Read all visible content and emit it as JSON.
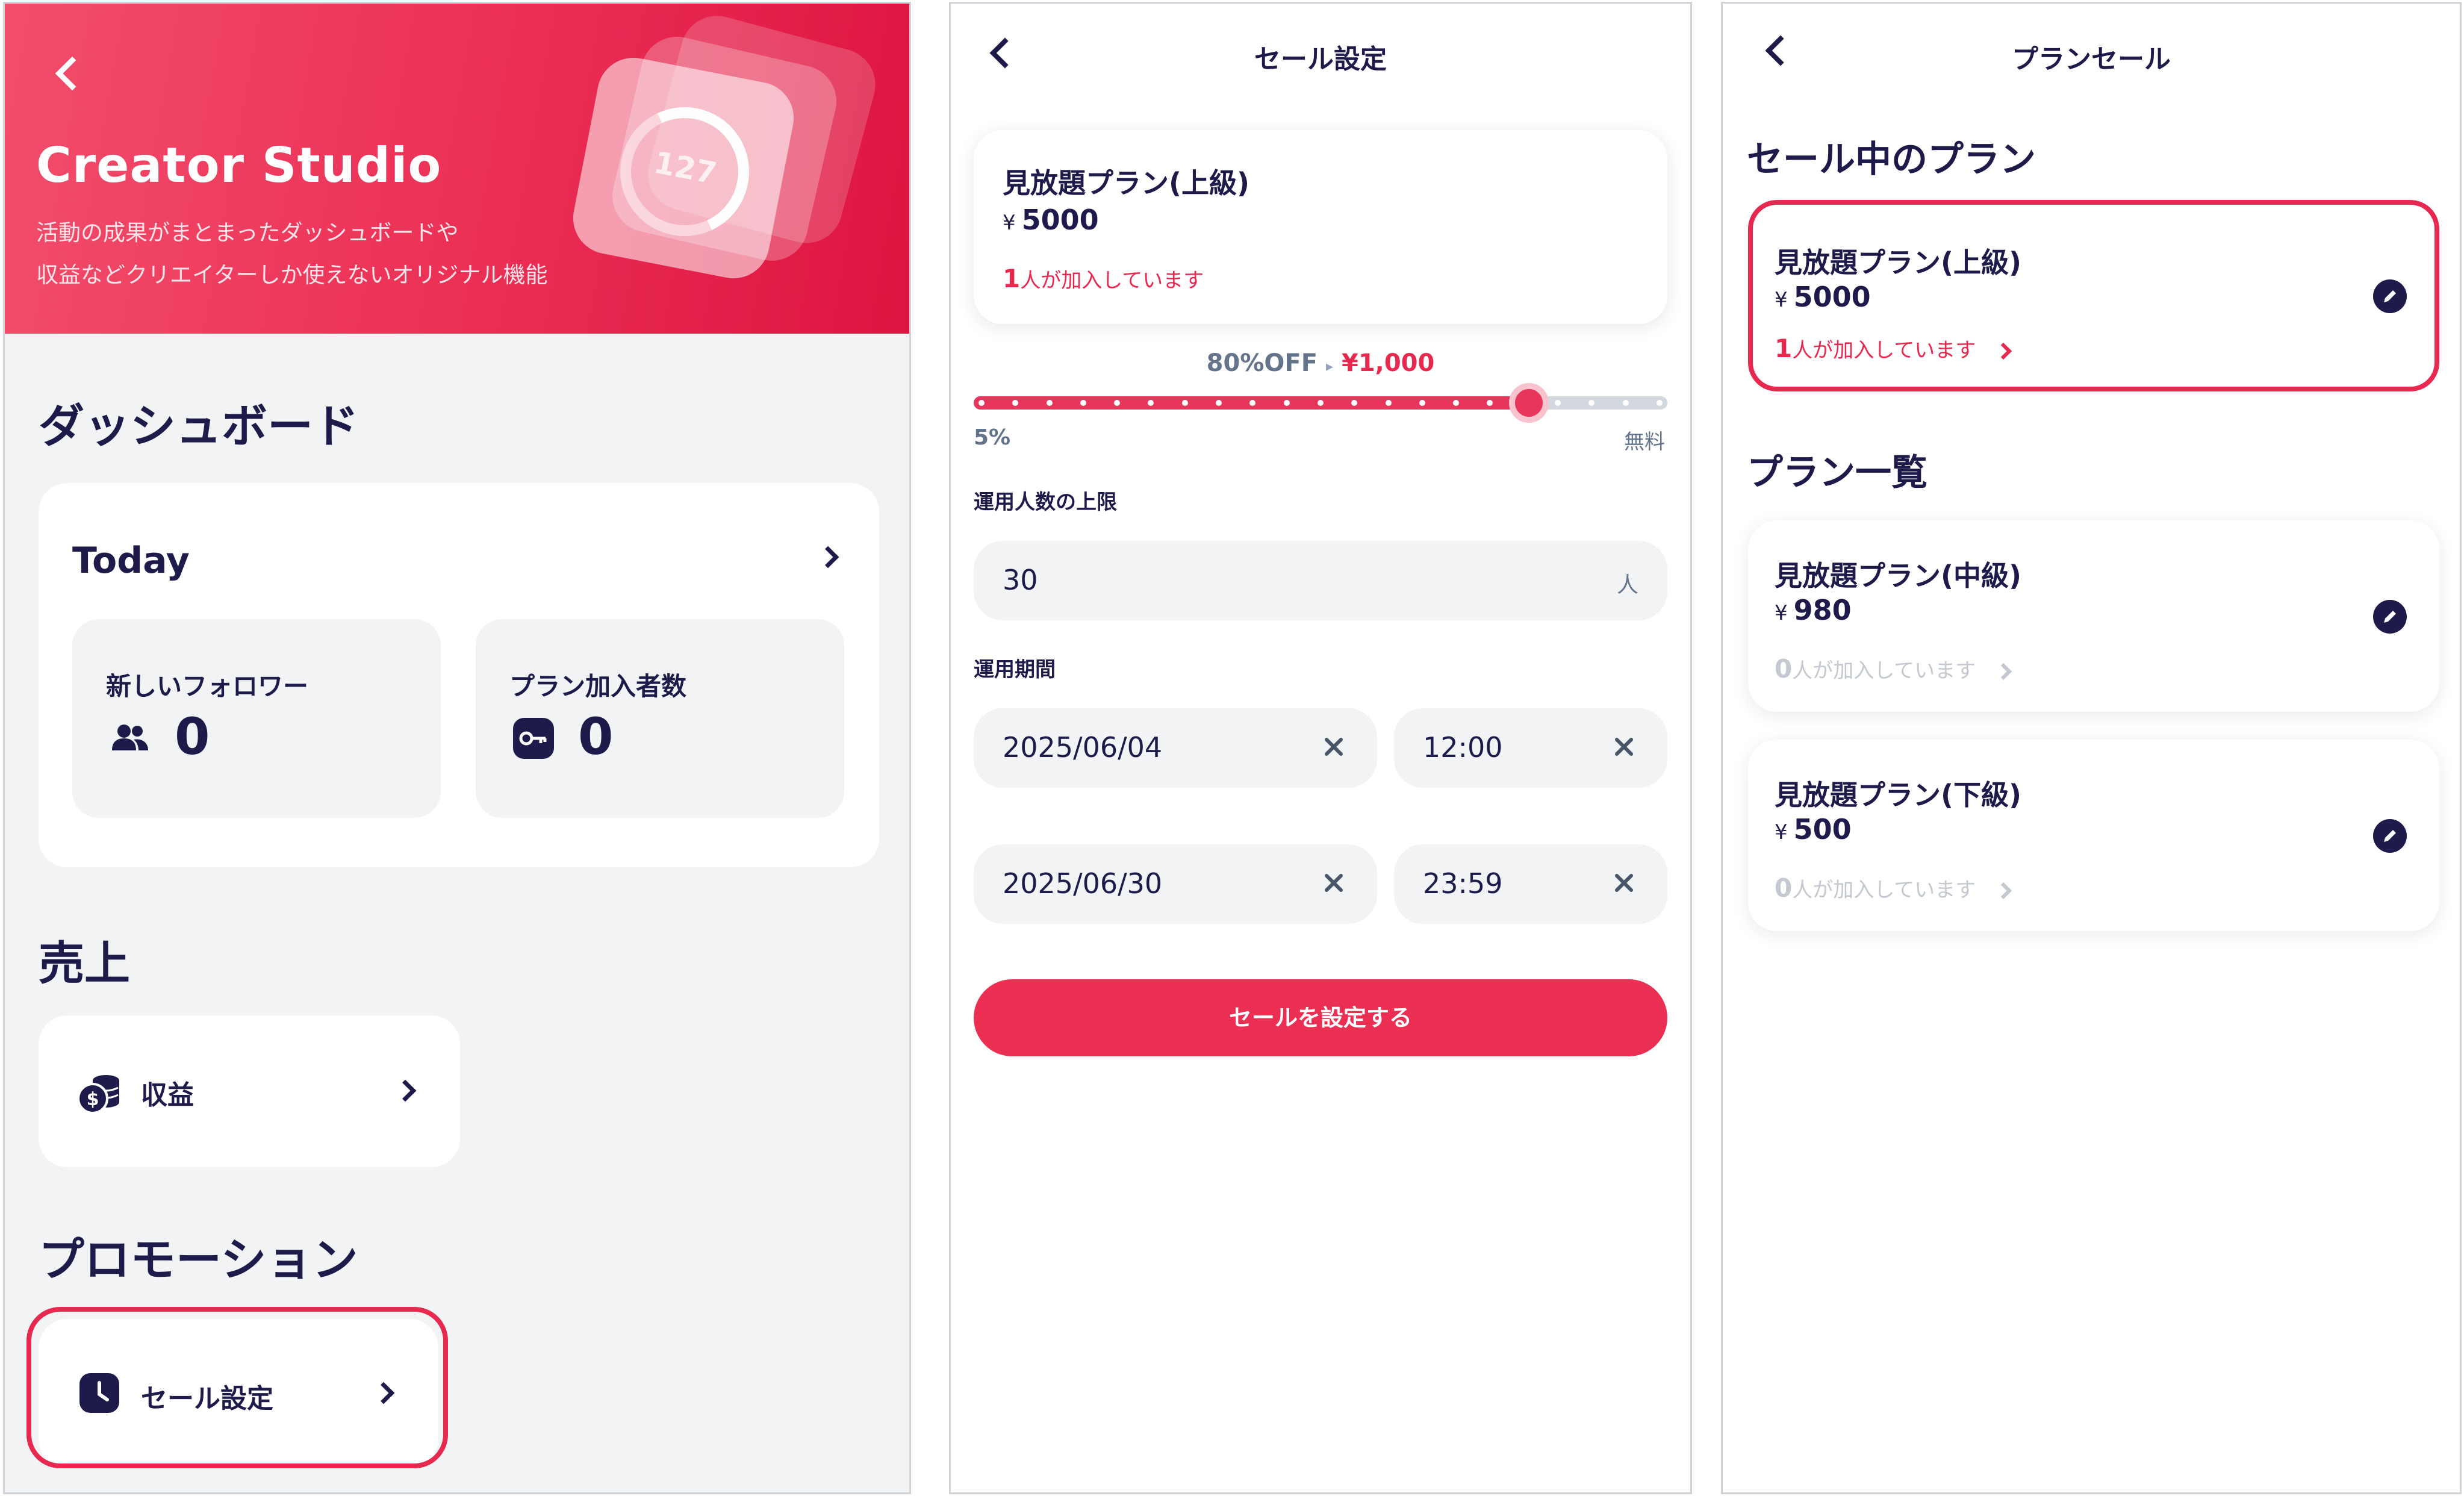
{
  "screen1": {
    "hero": {
      "title": "Creator Studio",
      "description_line1": "活動の成果がまとまったダッシュボードや",
      "description_line2": "収益などクリエイターしか使えないオリジナル機能",
      "decor_number": "127"
    },
    "dashboard": {
      "heading": "ダッシュボード",
      "card_title": "Today",
      "stats": [
        {
          "label": "新しいフォロワー",
          "value": "0",
          "icon": "users-icon"
        },
        {
          "label": "プラン加入者数",
          "value": "0",
          "icon": "key-icon"
        }
      ]
    },
    "sales": {
      "heading": "売上",
      "item_label": "収益",
      "icon": "coins-icon"
    },
    "promotion": {
      "heading": "プロモーション",
      "item_label": "セール設定",
      "icon": "clock-icon"
    }
  },
  "screen2": {
    "title": "セール設定",
    "plan": {
      "name": "見放題プラン(上級)",
      "currency": "¥",
      "price": "5000",
      "member_count": "1",
      "member_suffix": "人が加入しています"
    },
    "discount": {
      "off_label": "80%OFF",
      "sale_price": "¥1,000",
      "slider_fraction": 0.8,
      "min_label": "5%",
      "max_label": "無料"
    },
    "limit": {
      "label": "運用人数の上限",
      "value": "30",
      "unit": "人"
    },
    "period": {
      "label": "運用期間",
      "start_date": "2025/06/04",
      "start_time": "12:00",
      "end_date": "2025/06/30",
      "end_time": "23:59"
    },
    "submit_label": "セールを設定する"
  },
  "screen3": {
    "title": "プランセール",
    "on_sale_heading": "セール中のプラン",
    "list_heading": "プラン一覧",
    "member_suffix": "人が加入しています",
    "on_sale": {
      "name": "見放題プラン(上級)",
      "currency": "¥",
      "price": "5000",
      "member_count": "1"
    },
    "plans": [
      {
        "name": "見放題プラン(中級)",
        "currency": "¥",
        "price": "980",
        "member_count": "0"
      },
      {
        "name": "見放題プラン(下級)",
        "currency": "¥",
        "price": "500",
        "member_count": "0"
      }
    ]
  },
  "colors": {
    "accent": "#e8294f",
    "navy": "#1e1b4b",
    "muted": "#64748b",
    "panel": "#f2f3f5"
  }
}
